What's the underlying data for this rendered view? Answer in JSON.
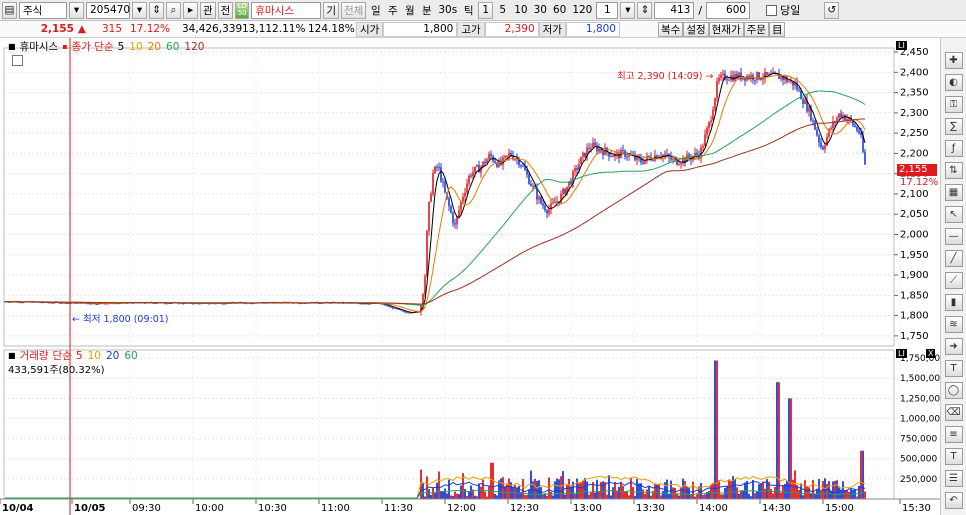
{
  "toolbar": {
    "market": "주식",
    "code": "205470",
    "btn_guan": "관",
    "btn_jeon": "전",
    "name": "휴마시스",
    "btn_gi": "기",
    "btn_gyeonche": "전체",
    "periods": [
      "일",
      "주",
      "월",
      "분",
      "30s",
      "틱"
    ],
    "intervals": [
      "1",
      "5",
      "10",
      "30",
      "60",
      "120"
    ],
    "spin_value": "1",
    "count": "413",
    "slash": "/",
    "total": "600",
    "today_label": "당일"
  },
  "infobar": {
    "price": "2,155",
    "arrow": "▲",
    "change": "315",
    "change_pct": "17.12%",
    "volume": "34,426,339",
    "vol_pct": "13,112.11%",
    "turnover_pct": "124.18%",
    "open_label": "시가",
    "open": "1,800",
    "high_label": "고가",
    "high": "2,390",
    "low_label": "저가",
    "low": "1,800",
    "btn_copy": "복수",
    "btn_setting": "설정",
    "btn_current": "현재가",
    "btn_order": "주문",
    "btn_grid": "目"
  },
  "price_panel": {
    "name": "휴마시스",
    "indicator_label": "종가 단순",
    "ma_periods": [
      "5",
      "10",
      "20",
      "60",
      "120"
    ],
    "ma_colors": [
      "#000000",
      "#e8a000",
      "#f07800",
      "#2aa05a",
      "#a03020"
    ],
    "high_note": "최고 2,390 (14:09)",
    "low_note": "최저 1,800 (09:01)",
    "current_tag": "2,155",
    "current_pct": "17.12%",
    "scale_mark": "LI"
  },
  "volume_panel": {
    "indicator_label": "거래량",
    "ma_label": "단순",
    "ma_periods": [
      "5",
      "10",
      "20",
      "60"
    ],
    "ma_colors": [
      "#e0191d",
      "#e8a000",
      "#1b3bd6",
      "#2aa05a"
    ],
    "value_note": "433,591주(80.32%)",
    "scale_mark": "LI",
    "close_mark": "X"
  },
  "chart_data": {
    "type": "candlestick",
    "price_axis": [
      "2,450",
      "2,400",
      "2,350",
      "2,300",
      "2,250",
      "2,200",
      "2,150",
      "2,100",
      "2,050",
      "2,000",
      "1,950",
      "1,900",
      "1,850",
      "1,800",
      "1,750"
    ],
    "price_ylim": [
      1725,
      2460
    ],
    "volume_axis": [
      "1,750,000",
      "1,500,000",
      "1,250,000",
      "1,000,000",
      "750,000",
      "500,000",
      "250,000"
    ],
    "volume_ylim": [
      0,
      1850000
    ],
    "time_axis": [
      "10/04",
      "10/05",
      "09:30",
      "10:00",
      "10:30",
      "11:00",
      "11:30",
      "12:00",
      "12:30",
      "13:00",
      "13:30",
      "14:00",
      "14:30",
      "15:00",
      "15:30"
    ],
    "price_path": [
      [
        0,
        1835
      ],
      [
        60,
        1832
      ],
      [
        95,
        1830
      ],
      [
        150,
        1832
      ],
      [
        200,
        1830
      ],
      [
        260,
        1832
      ],
      [
        320,
        1832
      ],
      [
        380,
        1830
      ],
      [
        405,
        1808
      ],
      [
        420,
        1810
      ],
      [
        425,
        1900
      ],
      [
        428,
        2050
      ],
      [
        433,
        2150
      ],
      [
        438,
        2170
      ],
      [
        445,
        2100
      ],
      [
        455,
        2020
      ],
      [
        462,
        2090
      ],
      [
        470,
        2150
      ],
      [
        480,
        2165
      ],
      [
        490,
        2195
      ],
      [
        500,
        2170
      ],
      [
        510,
        2200
      ],
      [
        520,
        2180
      ],
      [
        530,
        2130
      ],
      [
        540,
        2080
      ],
      [
        548,
        2060
      ],
      [
        560,
        2090
      ],
      [
        570,
        2130
      ],
      [
        580,
        2180
      ],
      [
        590,
        2220
      ],
      [
        600,
        2210
      ],
      [
        615,
        2195
      ],
      [
        625,
        2200
      ],
      [
        640,
        2180
      ],
      [
        650,
        2190
      ],
      [
        660,
        2200
      ],
      [
        675,
        2180
      ],
      [
        690,
        2190
      ],
      [
        700,
        2200
      ],
      [
        710,
        2280
      ],
      [
        718,
        2380
      ],
      [
        725,
        2390
      ],
      [
        740,
        2390
      ],
      [
        760,
        2390
      ],
      [
        780,
        2390
      ],
      [
        795,
        2370
      ],
      [
        810,
        2300
      ],
      [
        822,
        2210
      ],
      [
        830,
        2260
      ],
      [
        840,
        2300
      ],
      [
        850,
        2280
      ],
      [
        860,
        2250
      ],
      [
        866,
        2155
      ]
    ],
    "volume_bars_hint": "red/blue alternating volume bars with spikes near 14:05 (~1,720,000) and 14:30 (~1,450,000)"
  }
}
